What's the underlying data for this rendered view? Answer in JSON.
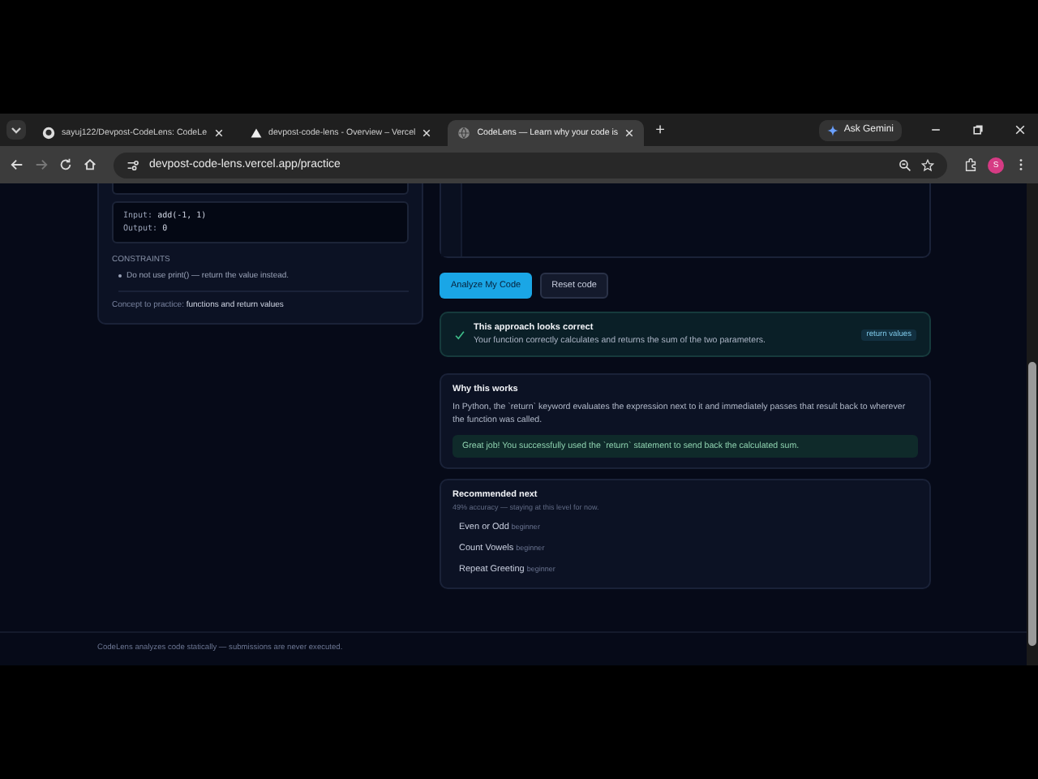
{
  "browser": {
    "tabs": [
      {
        "title": "sayuj122/Devpost-CodeLens: CodeLe",
        "selected": false
      },
      {
        "title": "devpost-code-lens - Overview – Vercel",
        "selected": false
      },
      {
        "title": "CodeLens — Learn why your code is",
        "selected": true
      }
    ],
    "new_tab": "+",
    "ask_gemini": "Ask Gemini",
    "address": "devpost-code-lens.vercel.app/practice",
    "profile": "S"
  },
  "problem_card": {
    "example": {
      "input_label": "Input:",
      "input": "add(-1, 1)",
      "output_label": "Output:",
      "output": "0"
    },
    "constraints_heading": "CONSTRAINTS",
    "constraints": [
      "Do not use print() — return the value instead."
    ],
    "concept_label": "Concept to practice:",
    "concept": "functions and return values"
  },
  "actions": {
    "analyze": "Analyze My Code",
    "reset": "Reset code"
  },
  "result": {
    "correct": true,
    "title": "This approach looks correct",
    "message": "Your function correctly calculates and returns the sum of the two parameters.",
    "tag": "return values"
  },
  "explanation": {
    "title": "Why this works",
    "body": "In Python, the `return` keyword evaluates the expression next to it and immediately passes that result back to wherever the function was called.",
    "praise": "Great job! You successfully used the `return` statement to send back the calculated sum."
  },
  "recommended": {
    "title": "Recommended next",
    "subtitle": "49% accuracy — staying at this level for now.",
    "items": [
      {
        "name": "Even or Odd",
        "level": "beginner"
      },
      {
        "name": "Count Vowels",
        "level": "beginner"
      },
      {
        "name": "Repeat Greeting",
        "level": "beginner"
      }
    ]
  },
  "footer": "CodeLens analyzes code statically — submissions are never executed."
}
